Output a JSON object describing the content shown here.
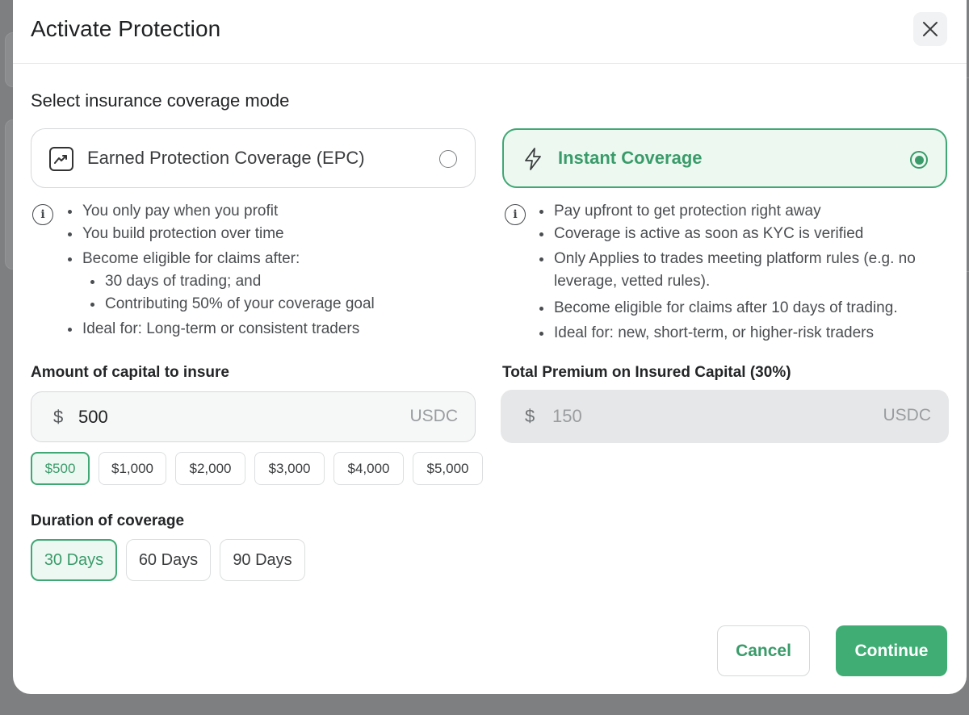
{
  "modal": {
    "title": "Activate Protection"
  },
  "coverage_mode": {
    "section_label": "Select insurance coverage mode",
    "selected": "instant",
    "epc": {
      "label": "Earned Protection Coverage (EPC)",
      "icon": "trending-up-icon",
      "bullets": [
        "You only pay when you profit",
        "You build protection over time",
        "Become eligible for claims after:",
        "30 days of trading; and",
        "Contributing 50% of your coverage goal",
        "Ideal for: Long-term or consistent traders"
      ]
    },
    "instant": {
      "label": "Instant Coverage",
      "icon": "lightning-icon",
      "bullets": [
        "Pay upfront to get protection right away",
        "Coverage is active as soon as KYC is verified",
        "Only Applies to trades meeting platform rules (e.g. no",
        "leverage, vetted rules).",
        "Become eligible for claims after 10 days of trading.",
        "Ideal for: new, short-term, or higher-risk traders"
      ]
    }
  },
  "amount": {
    "label": "Amount of capital to insure",
    "currency_symbol": "$",
    "value": "500",
    "unit": "USDC",
    "presets": [
      "$500",
      "$1,000",
      "$2,000",
      "$3,000",
      "$4,000",
      "$5,000"
    ],
    "selected_preset": "$500"
  },
  "premium": {
    "label": "Total Premium on Insured Capital (30%)",
    "currency_symbol": "$",
    "value": "150",
    "unit": "USDC"
  },
  "duration": {
    "label": "Duration of coverage",
    "options": [
      "30 Days",
      "60 Days",
      "90 Days"
    ],
    "selected": "30 Days"
  },
  "actions": {
    "cancel_label": "Cancel",
    "continue_label": "Continue"
  },
  "colors": {
    "accent": "#3fad74",
    "accent_text": "#3a9b6a",
    "accent_bg": "#edf8f1"
  }
}
